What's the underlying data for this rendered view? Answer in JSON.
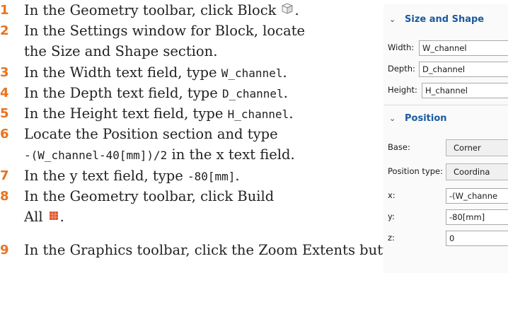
{
  "steps": [
    {
      "num": "1",
      "line1": "In the Geometry toolbar, click Block"
    },
    {
      "num": "2",
      "line1": "In the Settings window for Block, locate",
      "line2": "the Size and Shape section."
    },
    {
      "num": "3",
      "prefix": "In the Width text field, type ",
      "code": "W_channel",
      "suffix": "."
    },
    {
      "num": "4",
      "prefix": "In the Depth text field, type ",
      "code": "D_channel",
      "suffix": "."
    },
    {
      "num": "5",
      "prefix": "In the Height text field, type ",
      "code": "H_channel",
      "suffix": "."
    },
    {
      "num": "6",
      "line1": "Locate the Position section and type",
      "code": "-(W_channel-40[mm])/2",
      "suffix": " in the x text field."
    },
    {
      "num": "7",
      "prefix": "In the y text field, type ",
      "code": "-80[mm]",
      "suffix": "."
    },
    {
      "num": "8",
      "line1": "In the Geometry toolbar, click Build",
      "line2": "All"
    },
    {
      "num": "9",
      "line1": "In the Graphics toolbar, click the Zoom Extents button"
    }
  ],
  "period": ".",
  "panel": {
    "size_section": "Size and Shape",
    "width_label": "Width:",
    "width_value": "W_channel",
    "depth_label": "Depth:",
    "depth_value": "D_channel",
    "height_label": "Height:",
    "height_value": "H_channel",
    "position_section": "Position",
    "base_label": "Base:",
    "base_value": "Corner",
    "postype_label": "Position type:",
    "postype_value": "Coordina",
    "x_label": "x:",
    "x_value": "-(W_channe",
    "y_label": "y:",
    "y_value": "-80[mm]",
    "z_label": "z:",
    "z_value": "0"
  },
  "icons": {
    "block": "block-icon",
    "build_all": "build-all-icon",
    "zoom_extents": "zoom-extents-icon",
    "chevron": "chevron-down-icon"
  }
}
